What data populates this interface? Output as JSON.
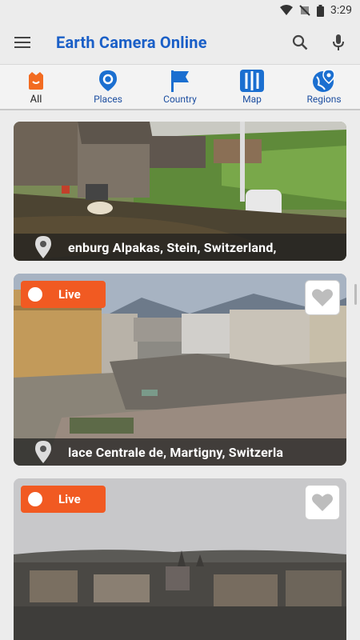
{
  "status_bar": {
    "time": "3:29"
  },
  "app_bar": {
    "title": "Earth Camera Online"
  },
  "tabs": [
    {
      "label": "All",
      "active": true
    },
    {
      "label": "Places"
    },
    {
      "label": "Country"
    },
    {
      "label": "Map"
    },
    {
      "label": "Regions"
    }
  ],
  "cards": [
    {
      "caption": "enburg Alpakas, Stein, Switzerland,"
    },
    {
      "live_label": "Live",
      "caption": "lace Centrale de, Martigny, Switzerla"
    },
    {
      "live_label": "Live"
    }
  ],
  "colors": {
    "accent": "#1a5fc7",
    "live": "#f15a22"
  }
}
